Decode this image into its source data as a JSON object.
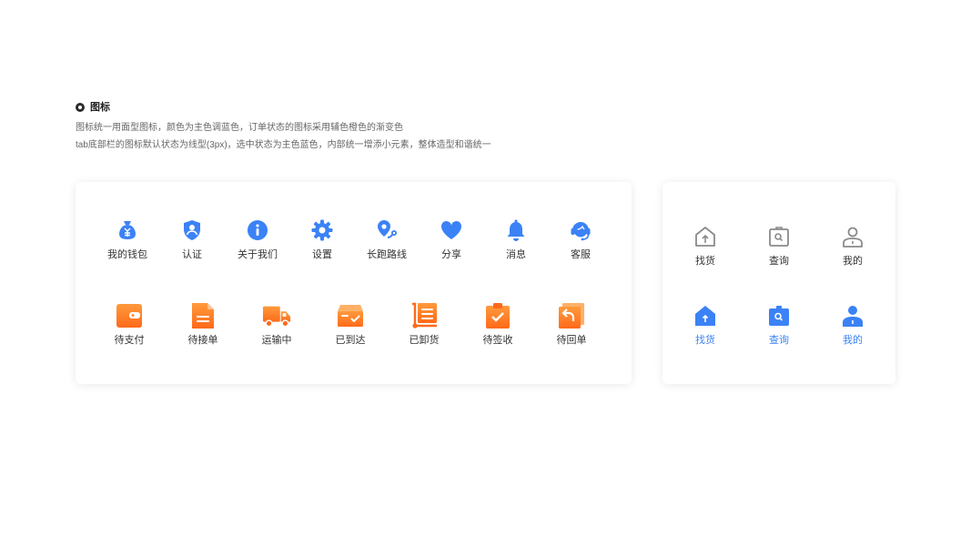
{
  "section": {
    "title": "图标",
    "desc_line1": "图标统一用面型图标，颜色为主色调蓝色，订单状态的图标采用辅色橙色的渐变色",
    "desc_line2": "tab底部栏的图标默认状态为线型(3px)，选中状态为主色蓝色，内部统一增添小元素，整体造型和谐统一"
  },
  "colors": {
    "primary_blue": "#3b82f6",
    "orange_light": "#ff9a3c",
    "orange_dark": "#ff6a1a",
    "outline_gray": "#8a8a8a",
    "text": "#333333"
  },
  "blue_icons": [
    {
      "label": "我的钱包",
      "icon": "money-bag-icon"
    },
    {
      "label": "认证",
      "icon": "shield-user-icon"
    },
    {
      "label": "关于我们",
      "icon": "info-icon"
    },
    {
      "label": "设置",
      "icon": "gear-icon"
    },
    {
      "label": "长跑路线",
      "icon": "route-pin-icon"
    },
    {
      "label": "分享",
      "icon": "heart-icon"
    },
    {
      "label": "消息",
      "icon": "bell-icon"
    },
    {
      "label": "客服",
      "icon": "headset-icon"
    }
  ],
  "order_icons": [
    {
      "label": "待支付",
      "icon": "wallet-icon"
    },
    {
      "label": "待接单",
      "icon": "document-icon"
    },
    {
      "label": "运输中",
      "icon": "truck-icon"
    },
    {
      "label": "已到达",
      "icon": "box-check-icon"
    },
    {
      "label": "已卸货",
      "icon": "handcart-icon"
    },
    {
      "label": "待签收",
      "icon": "clipboard-check-icon"
    },
    {
      "label": "待回单",
      "icon": "return-receipt-icon"
    }
  ],
  "tab_bar": {
    "default": [
      {
        "label": "找货",
        "icon": "house-upload-icon"
      },
      {
        "label": "查询",
        "icon": "search-box-icon"
      },
      {
        "label": "我的",
        "icon": "user-icon"
      }
    ],
    "selected": [
      {
        "label": "找货",
        "icon": "house-upload-icon"
      },
      {
        "label": "查询",
        "icon": "search-box-icon"
      },
      {
        "label": "我的",
        "icon": "user-icon"
      }
    ]
  }
}
